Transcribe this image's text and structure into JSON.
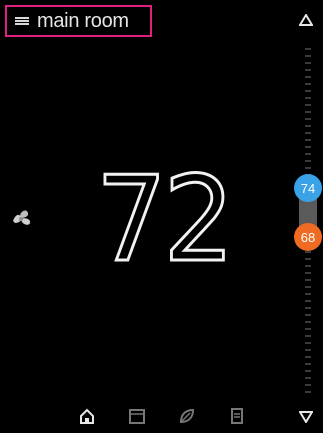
{
  "header": {
    "room_name": "main room"
  },
  "thermostat": {
    "current_temperature": "72",
    "cool_setpoint": "74",
    "heat_setpoint": "68"
  },
  "colors": {
    "cool": "#3aa2e6",
    "heat": "#ef6a22",
    "highlight": "#e0217f"
  },
  "icons": {
    "menu": "menu-icon",
    "up": "triangle-up-icon",
    "down": "triangle-down-icon",
    "fan": "fan-icon",
    "home": "home-icon",
    "schedule": "schedule-icon",
    "energy": "leaf-icon",
    "history": "document-icon"
  }
}
